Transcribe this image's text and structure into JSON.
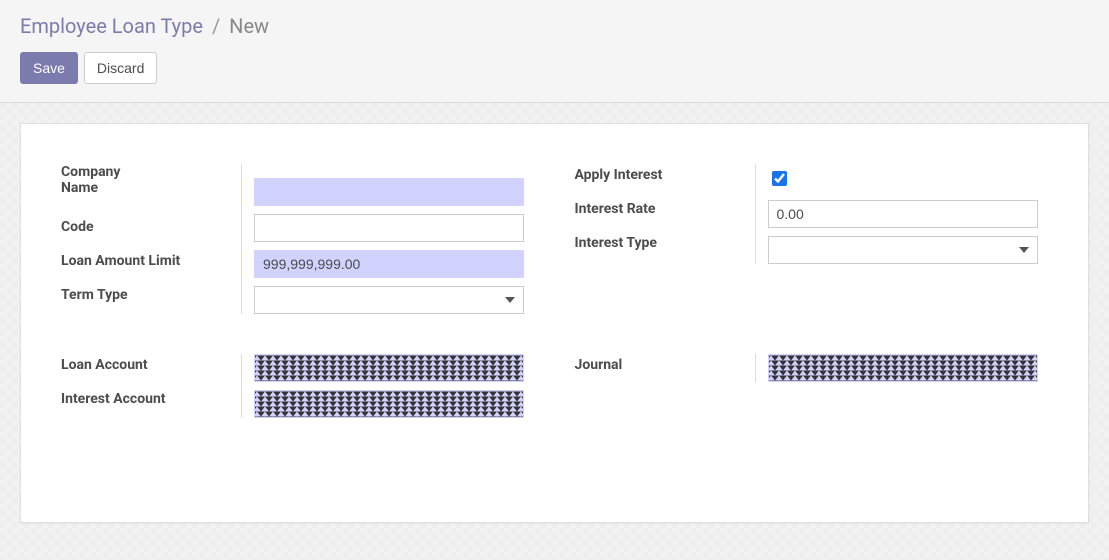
{
  "breadcrumb": {
    "root": "Employee Loan Type",
    "separator": "/",
    "leaf": "New"
  },
  "actions": {
    "save": "Save",
    "discard": "Discard"
  },
  "form": {
    "left1": {
      "company_name_label": "Company\nName",
      "company_name_value": "",
      "code_label": "Code",
      "code_value": "",
      "loan_amount_limit_label": "Loan Amount Limit",
      "loan_amount_limit_value": "999,999,999.00",
      "term_type_label": "Term Type",
      "term_type_value": ""
    },
    "right1": {
      "apply_interest_label": "Apply Interest",
      "apply_interest_checked": true,
      "interest_rate_label": "Interest Rate",
      "interest_rate_value": "0.00",
      "interest_type_label": "Interest Type",
      "interest_type_value": ""
    },
    "left2": {
      "loan_account_label": "Loan Account",
      "loan_account_value": "",
      "interest_account_label": "Interest Account",
      "interest_account_value": ""
    },
    "right2": {
      "journal_label": "Journal",
      "journal_value": ""
    }
  }
}
